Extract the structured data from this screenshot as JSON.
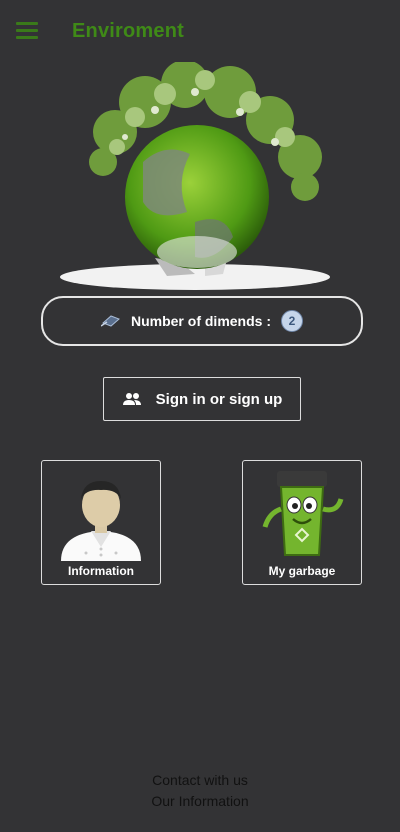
{
  "app": {
    "title": "Enviroment"
  },
  "counter": {
    "label": "Number of dimends :",
    "value": "2"
  },
  "signin": {
    "label": "Sign in or sign up"
  },
  "cards": [
    {
      "label": "Information",
      "icon": "person-icon"
    },
    {
      "label": "My garbage",
      "icon": "recycle-bin-icon"
    }
  ],
  "footer": {
    "contact": "Contact with us",
    "info": "Our Information"
  },
  "colors": {
    "background": "#333335",
    "brand_green": "#3f8a17"
  }
}
